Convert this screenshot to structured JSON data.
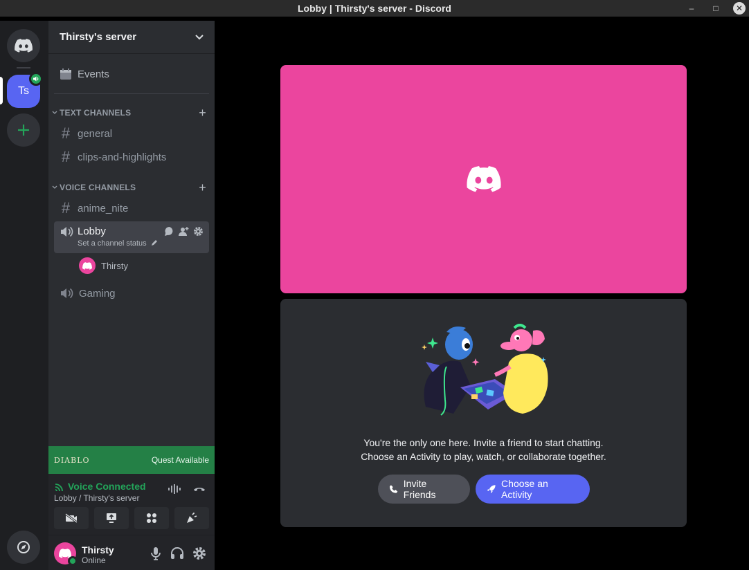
{
  "window": {
    "title": "Lobby | Thirsty's server - Discord",
    "minimize": "–",
    "maximize": "□",
    "close": "✕"
  },
  "rail": {
    "server_initials": "Ts"
  },
  "sidebar": {
    "server_name": "Thirsty's server",
    "events_label": "Events",
    "text_category": "TEXT CHANNELS",
    "text_channels": [
      "general",
      "clips-and-highlights"
    ],
    "voice_category": "VOICE CHANNELS",
    "voice_channels": [
      "anime_nite",
      "Lobby",
      "Gaming"
    ],
    "lobby_status": "Set a channel status",
    "lobby_user": "Thirsty"
  },
  "quest": {
    "game_logo": "DIABLO",
    "label": "Quest Available"
  },
  "voice_panel": {
    "title": "Voice Connected",
    "subtitle": "Lobby / Thirsty's server"
  },
  "user": {
    "name": "Thirsty",
    "status": "Online"
  },
  "main": {
    "empty_line1": "You're the only one here. Invite a friend to start chatting.",
    "empty_line2": "Choose an Activity to play, watch, or collaborate together.",
    "invite_label": "Invite Friends",
    "activity_label": "Choose an Activity"
  },
  "colors": {
    "blurple": "#5865f2",
    "pink": "#eb459e",
    "green": "#23a55a",
    "sidebar": "#2b2d31",
    "rail": "#1e1f22"
  }
}
